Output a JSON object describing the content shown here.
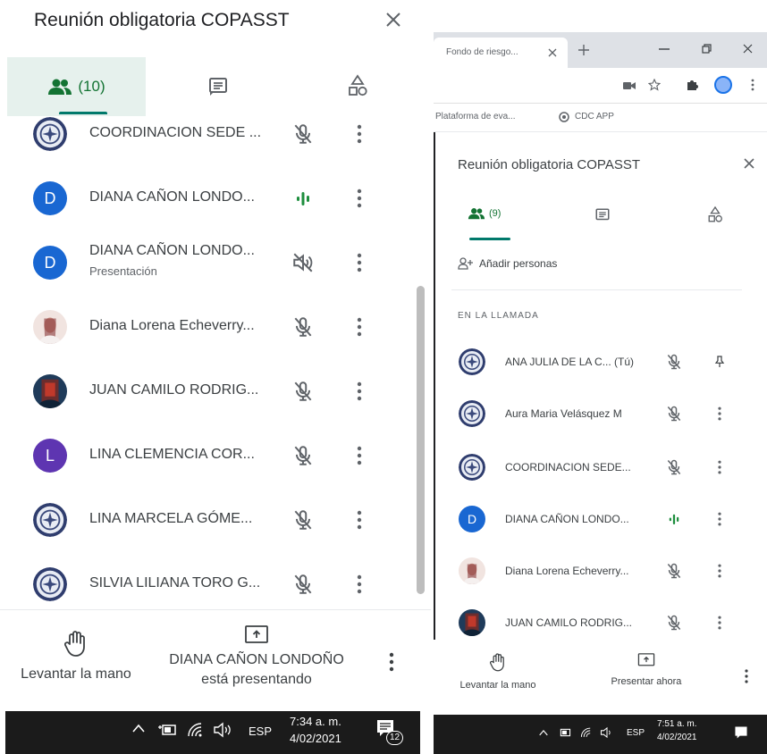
{
  "left": {
    "title": "Reunión obligatoria COPASST",
    "tabs": {
      "people_count": "(10)"
    },
    "participants": [
      {
        "name": "COORDINACION SEDE ...",
        "subtitle": "",
        "avatar_letter": "",
        "avatar_type": "seal",
        "status": "muted"
      },
      {
        "name": "DIANA CAÑON LONDO...",
        "subtitle": "",
        "avatar_letter": "D",
        "avatar_type": "letter",
        "avatar_color": "#1967d2",
        "status": "speaking"
      },
      {
        "name": "DIANA CAÑON LONDO...",
        "subtitle": "Presentación",
        "avatar_letter": "D",
        "avatar_type": "letter",
        "avatar_color": "#1967d2",
        "status": "audio-off"
      },
      {
        "name": "Diana Lorena Echeverry...",
        "subtitle": "",
        "avatar_letter": "",
        "avatar_type": "photo-pink",
        "status": "muted"
      },
      {
        "name": "JUAN CAMILO RODRIG...",
        "subtitle": "",
        "avatar_letter": "",
        "avatar_type": "photo-dark",
        "status": "muted"
      },
      {
        "name": "LINA CLEMENCIA COR...",
        "subtitle": "",
        "avatar_letter": "L",
        "avatar_type": "letter",
        "avatar_color": "#5e35b1",
        "status": "muted"
      },
      {
        "name": "LINA MARCELA GÓME...",
        "subtitle": "",
        "avatar_letter": "",
        "avatar_type": "seal",
        "status": "muted"
      },
      {
        "name": "SILVIA LILIANA TORO G...",
        "subtitle": "",
        "avatar_letter": "",
        "avatar_type": "seal",
        "status": "muted"
      }
    ],
    "footer": {
      "raise_hand": "Levantar la mano",
      "presenting_line1": "DIANA CAÑON LONDOÑO",
      "presenting_line2": "está presentando"
    },
    "taskbar": {
      "lang": "ESP",
      "time": "7:34 a. m.",
      "date": "4/02/2021",
      "notifications": "12"
    }
  },
  "right": {
    "browser": {
      "tab_title": "Fondo de riesgo...",
      "bookmark1": "Plataforma de eva...",
      "bookmark2": "CDC APP"
    },
    "title": "Reunión obligatoria COPASST",
    "tabs": {
      "people_count": "(9)"
    },
    "add_people": "Añadir personas",
    "section_label": "EN LA LLAMADA",
    "participants": [
      {
        "name": "ANA JULIA DE LA C... (Tú)",
        "avatar_type": "seal",
        "avatar_letter": "",
        "status": "muted",
        "action": "pin"
      },
      {
        "name": "Aura Maria Velásquez M",
        "avatar_type": "seal",
        "avatar_letter": "",
        "status": "muted",
        "action": "more"
      },
      {
        "name": "COORDINACION SEDE...",
        "avatar_type": "seal",
        "avatar_letter": "",
        "status": "muted",
        "action": "more"
      },
      {
        "name": "DIANA CAÑON LONDO...",
        "avatar_type": "letter",
        "avatar_letter": "D",
        "avatar_color": "#1967d2",
        "status": "speaking",
        "action": "more"
      },
      {
        "name": "Diana Lorena Echeverry...",
        "avatar_type": "photo-pink",
        "avatar_letter": "",
        "status": "muted",
        "action": "more"
      },
      {
        "name": "JUAN CAMILO RODRIG...",
        "avatar_type": "photo-dark",
        "avatar_letter": "",
        "status": "muted",
        "action": "more"
      }
    ],
    "footer": {
      "raise_hand": "Levantar la mano",
      "present_now": "Presentar ahora"
    },
    "taskbar": {
      "lang": "ESP",
      "time": "7:51 a. m.",
      "date": "4/02/2021"
    }
  },
  "colors": {
    "accent": "#00796b",
    "accent_bg": "#e6f1ed",
    "speaking": "#1e8e3e",
    "icon": "#5f6368"
  }
}
